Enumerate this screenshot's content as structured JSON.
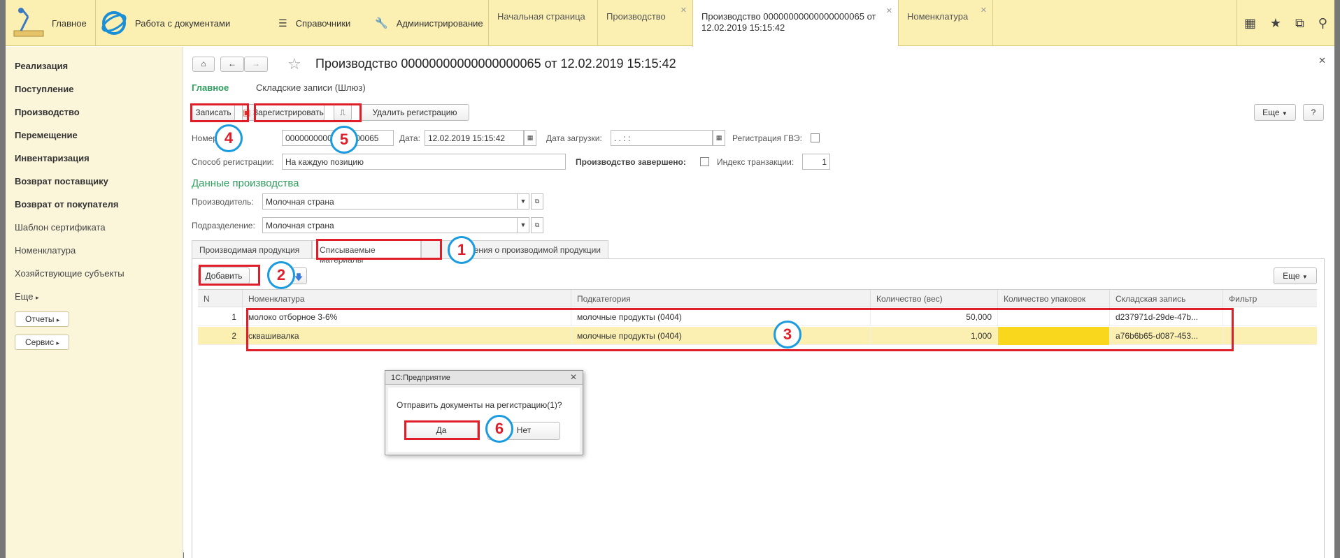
{
  "topbar": {
    "main_label": "Главное",
    "docs_label": "Работа с документами",
    "refs_label": "Справочники",
    "admin_label": "Администрирование",
    "tabs": [
      {
        "label": "Начальная страница"
      },
      {
        "label": "Производство"
      },
      {
        "label": "Производство 00000000000000000065 от 12.02.2019 15:15:42"
      },
      {
        "label": "Номенклатура"
      }
    ]
  },
  "sidebar": {
    "items": [
      {
        "label": "Реализация"
      },
      {
        "label": "Поступление"
      },
      {
        "label": "Производство"
      },
      {
        "label": "Перемещение"
      },
      {
        "label": "Инвентаризация"
      },
      {
        "label": "Возврат поставщику"
      },
      {
        "label": "Возврат от покупателя"
      },
      {
        "label": "Шаблон сертификата"
      },
      {
        "label": "Номенклатура"
      },
      {
        "label": "Хозяйствующие субъекты"
      },
      {
        "label": "Еще"
      }
    ],
    "reports_label": "Отчеты",
    "service_label": "Сервис"
  },
  "doc": {
    "title": "Производство 00000000000000000065 от 12.02.2019 15:15:42",
    "nav_main": "Главное",
    "nav_records": "Складские записи (Шлюз)",
    "toolbar": {
      "save": "Записать",
      "register": "Зарегистрировать",
      "delete_reg": "Удалить регистрацию",
      "more": "Еще",
      "help": "?"
    },
    "fields": {
      "number_label": "Номер:",
      "number_value": "00000000000000000065",
      "date_label": "Дата:",
      "date_value": "12.02.2019 15:15:42",
      "load_date_label": "Дата загрузки:",
      "load_date_value": "  .  .       :  :  ",
      "gvz_label": "Регистрация ГВЭ:",
      "reg_method_label": "Способ регистрации:",
      "reg_method_value": "На каждую позицию",
      "done_label": "Производство завершено:",
      "trans_label": "Индекс транзакции:",
      "trans_value": "1"
    },
    "production_section": "Данные производства",
    "producer_label": "Производитель:",
    "producer_value": "Молочная страна",
    "division_label": "Подразделение:",
    "division_value": "Молочная страна",
    "tabs": [
      {
        "label": "Производимая продукция"
      },
      {
        "label": "Списываемые материалы"
      },
      {
        "label": "Сведения о производимой продукции"
      }
    ],
    "add_button": "Добавить",
    "table_more": "Еще",
    "table": {
      "headers": [
        "N",
        "Номенклатура",
        "Подкатегория",
        "Количество (вес)",
        "Количество упаковок",
        "Складская запись",
        "Фильтр"
      ],
      "rows": [
        {
          "n": "1",
          "item": "молоко отборное 3-6%",
          "sub": "молочные продукты (0404)",
          "qty": "50,000",
          "packs": "",
          "rec": "d237971d-29de-47b...",
          "filter": ""
        },
        {
          "n": "2",
          "item": "сквашивалка",
          "sub": "молочные продукты (0404)",
          "qty": "1,000",
          "packs": "",
          "rec": "a76b6b65-d087-453...",
          "filter": ""
        }
      ]
    }
  },
  "dialog": {
    "title": "1С:Предприятие",
    "message": "Отправить документы на регистрацию(1)?",
    "yes": "Да",
    "no": "Нет"
  },
  "annotations": [
    "1",
    "2",
    "3",
    "4",
    "5",
    "6"
  ],
  "colors": {
    "accent_green": "#2e9e5e",
    "annotation_red": "#e01e2a",
    "annotation_blue": "#1a9be0",
    "selected_row": "#fbf0b2",
    "highlight_cell": "#f9d71c"
  }
}
